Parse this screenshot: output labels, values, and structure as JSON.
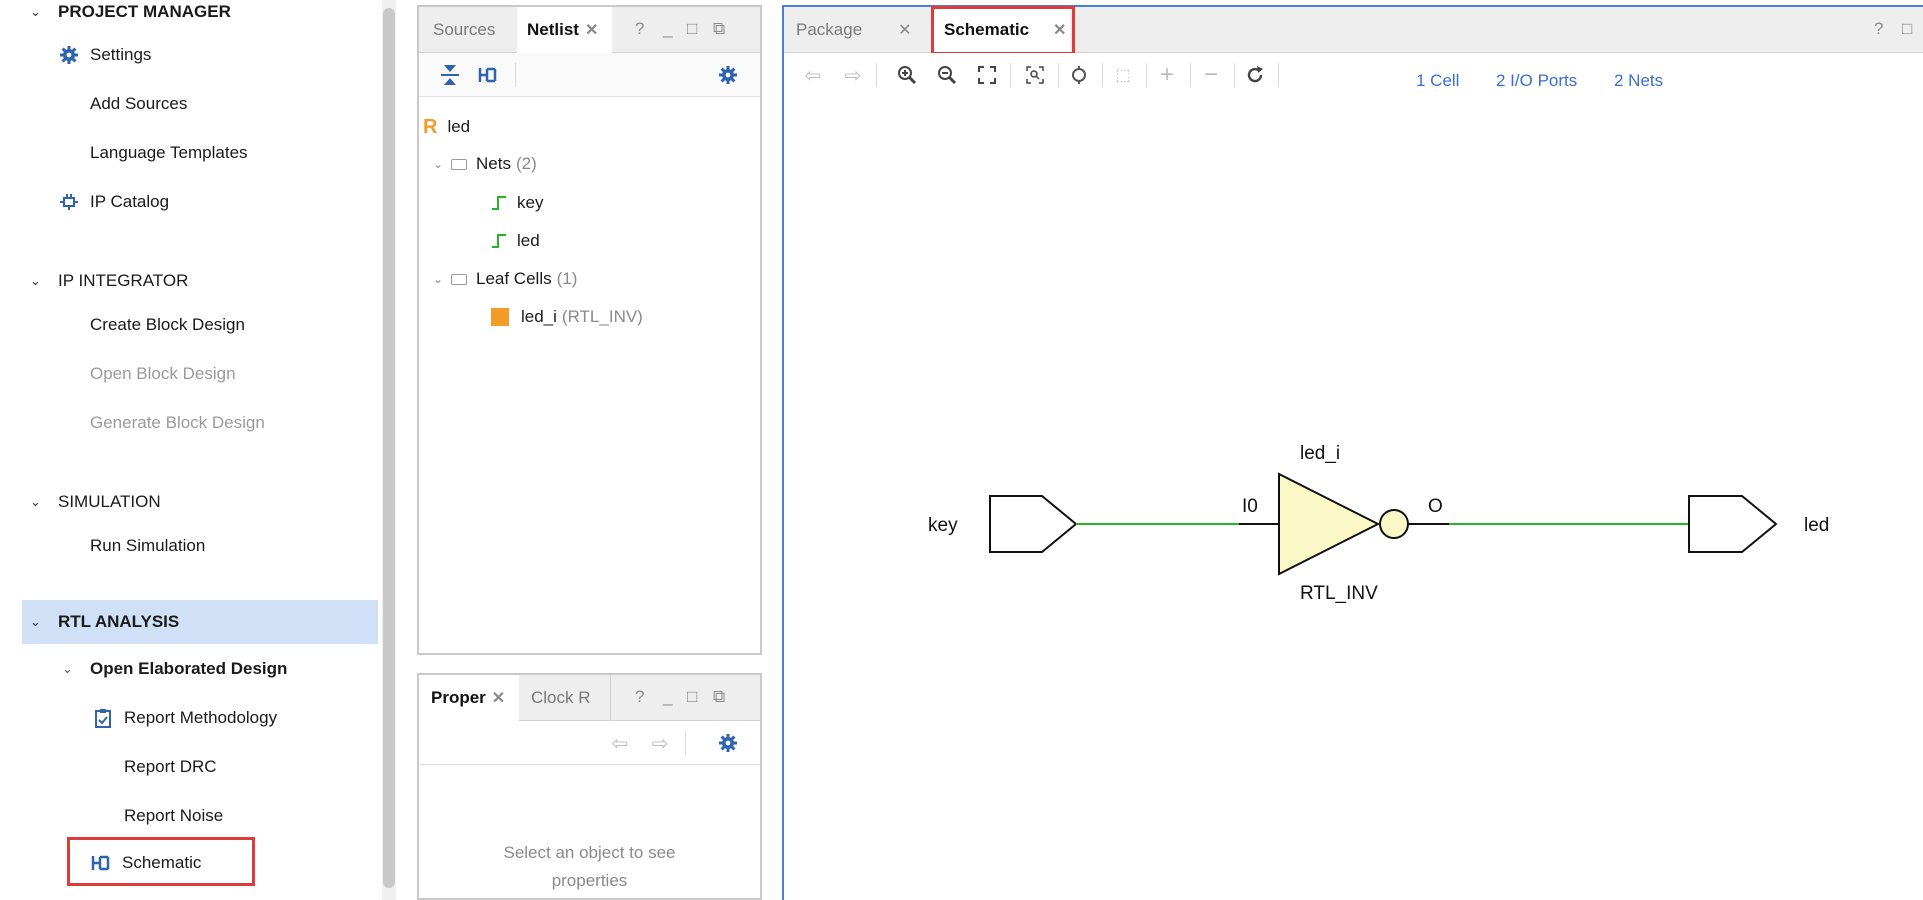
{
  "flow_navigator": {
    "project_manager": {
      "title": "PROJECT MANAGER",
      "items": [
        "Settings",
        "Add Sources",
        "Language Templates",
        "IP Catalog"
      ]
    },
    "ip_integrator": {
      "title": "IP INTEGRATOR",
      "items": [
        "Create Block Design",
        "Open Block Design",
        "Generate Block Design"
      ]
    },
    "simulation": {
      "title": "SIMULATION",
      "items": [
        "Run Simulation"
      ]
    },
    "rtl_analysis": {
      "title": "RTL ANALYSIS",
      "subgroup": "Open Elaborated Design",
      "items": [
        "Report Methodology",
        "Report DRC",
        "Report Noise",
        "Schematic"
      ]
    }
  },
  "netlist_panel": {
    "tabs": [
      "Sources",
      "Netlist"
    ],
    "controls": [
      "?",
      "_",
      "□",
      "⧉"
    ],
    "root_badge": "R",
    "root": "led",
    "nets_label": "Nets",
    "nets_count": "(2)",
    "nets": [
      "key",
      "led"
    ],
    "leaf_label": "Leaf Cells",
    "leaf_count": "(1)",
    "cell_name": "led_i",
    "cell_type": "(RTL_INV)"
  },
  "properties_panel": {
    "tabs": [
      "Proper",
      "Clock R"
    ],
    "controls": [
      "?",
      "_",
      "□",
      "⧉"
    ],
    "empty_line1": "Select an object to see",
    "empty_line2": "properties"
  },
  "schematic_panel": {
    "tabs": [
      "Package",
      "Schematic"
    ],
    "controls": [
      "?",
      "□"
    ],
    "stats": [
      "1 Cell",
      "2 I/O Ports",
      "2 Nets"
    ],
    "diagram": {
      "input_port": "key",
      "output_port": "led",
      "cell_instance": "led_i",
      "cell_type": "RTL_INV",
      "input_pin": "I0",
      "output_pin": "O"
    }
  },
  "colors": {
    "accent_blue": "#3a6fd0",
    "selection": "#cfe0f7",
    "highlight_red": "#e03b3b",
    "wire_green": "#2ab32a",
    "gate_fill": "#fbf8c8",
    "cell_orange": "#f39c27"
  },
  "icons": [
    "gear-icon",
    "ip-catalog-icon",
    "report-methodology-icon",
    "schematic-icon",
    "folder-icon",
    "net-icon",
    "cell-icon"
  ]
}
